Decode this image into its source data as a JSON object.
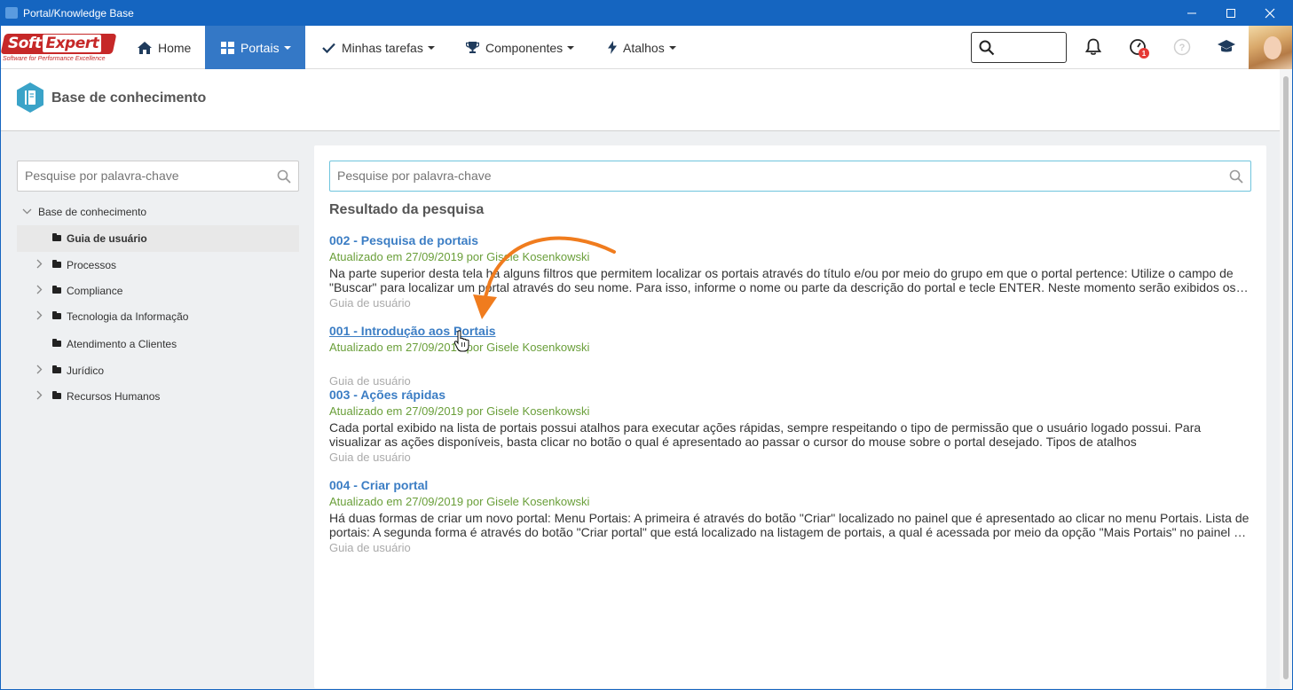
{
  "window": {
    "title": "Portal/Knowledge Base",
    "controls": [
      "minimize",
      "maximize",
      "close"
    ]
  },
  "nav": {
    "logo_text_1": "Soft",
    "logo_text_2": "Expert",
    "logo_tagline": "Software for Performance Excellence",
    "items": [
      {
        "label": "Home",
        "icon": "home-icon",
        "active": false
      },
      {
        "label": "Portais",
        "icon": "grid-icon",
        "active": true
      },
      {
        "label": "Minhas tarefas",
        "icon": "check-icon",
        "active": false
      },
      {
        "label": "Componentes",
        "icon": "trophy-icon",
        "active": false
      },
      {
        "label": "Atalhos",
        "icon": "bolt-icon",
        "active": false
      }
    ],
    "notification_badge": "1"
  },
  "page": {
    "title": "Base de conhecimento"
  },
  "left": {
    "search_placeholder": "Pesquise por palavra-chave",
    "tree": {
      "root": "Base de conhecimento",
      "items": [
        {
          "label": "Guia de usuário",
          "selected": true,
          "expandable": false
        },
        {
          "label": "Processos",
          "selected": false,
          "expandable": true
        },
        {
          "label": "Compliance",
          "selected": false,
          "expandable": true
        },
        {
          "label": "Tecnologia da Informação",
          "selected": false,
          "expandable": true
        },
        {
          "label": "Atendimento a Clientes",
          "selected": false,
          "expandable": false
        },
        {
          "label": "Jurídico",
          "selected": false,
          "expandable": true
        },
        {
          "label": "Recursos Humanos",
          "selected": false,
          "expandable": true
        }
      ]
    }
  },
  "main": {
    "search_placeholder": "Pesquise por palavra-chave",
    "results_heading": "Resultado da pesquisa",
    "results": [
      {
        "title": "002 - Pesquisa de portais",
        "meta": "Atualizado em 27/09/2019 por Gisele Kosenkowski",
        "description": "Na parte superior desta tela há alguns filtros que permitem localizar os portais através do título e/ou por meio do grupo em que o portal pertence: Utilize o campo de \"Buscar\" para localizar um portal através do seu nome. Para isso, informe o nome ou parte da descrição do portal e tecle ENTER. Neste momento serão exibidos os portais que correspondem ao critério informado.",
        "category": "Guia de usuário"
      },
      {
        "title": "001 - Introdução aos Portais",
        "meta": "Atualizado em 27/09/2019 por Gisele Kosenkowski",
        "description": "",
        "category": "Guia de usuário"
      },
      {
        "title": "003 - Ações rápidas",
        "meta": "Atualizado em 27/09/2019 por Gisele Kosenkowski",
        "description": "Cada portal exibido na lista de portais possui atalhos para executar ações rápidas, sempre respeitando o tipo de permissão que o usuário logado possui. Para visualizar as ações disponíveis, basta clicar no botão o qual é apresentado ao passar o cursor do mouse sobre o portal desejado. Tipos de atalhos",
        "category": "Guia de usuário"
      },
      {
        "title": "004 - Criar portal",
        "meta": "Atualizado em 27/09/2019 por Gisele Kosenkowski",
        "description": "Há duas formas de criar um novo portal: Menu Portais: A primeira é através do botão \"Criar\" localizado no painel que é apresentado ao clicar no menu Portais. Lista de portais: A segunda forma é através do botão \"Criar portal\" que está localizado na listagem de portais, a qual é acessada por meio da opção \"Mais Portais\" no painel do menu Portais.",
        "category": "Guia de usuário"
      }
    ]
  },
  "colors": {
    "titlebar": "#1565c0",
    "nav_active": "#3478c6",
    "link": "#3b7dc4",
    "meta": "#6a9f3a",
    "annotation_arrow": "#f07c1e"
  }
}
